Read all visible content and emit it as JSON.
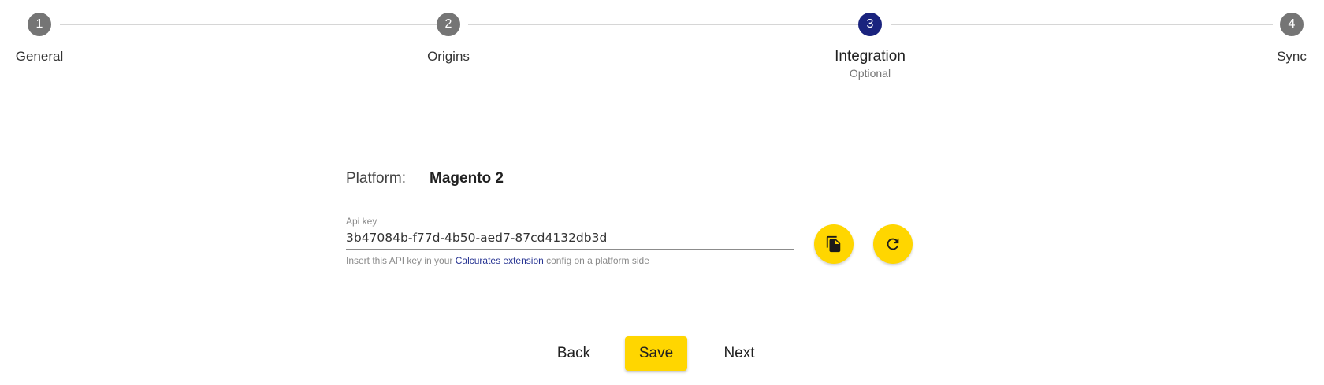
{
  "stepper": {
    "steps": [
      {
        "number": "1",
        "label": "General",
        "sublabel": "",
        "active": false
      },
      {
        "number": "2",
        "label": "Origins",
        "sublabel": "",
        "active": false
      },
      {
        "number": "3",
        "label": "Integration",
        "sublabel": "Optional",
        "active": true
      },
      {
        "number": "4",
        "label": "Sync",
        "sublabel": "",
        "active": false
      }
    ]
  },
  "platform": {
    "label": "Platform:",
    "value": "Magento 2"
  },
  "api_key": {
    "label": "Api key",
    "value": "3b47084b-f77d-4b50-aed7-87cd4132db3d",
    "hint_prefix": "Insert this API key in your ",
    "hint_link": "Calcurates extension",
    "hint_suffix": " config on a platform side",
    "copy_icon": "copy-icon",
    "refresh_icon": "refresh-icon"
  },
  "actions": {
    "back_label": "Back",
    "save_label": "Save",
    "next_label": "Next"
  },
  "colors": {
    "accent": "#ffd600",
    "active_step": "#1a237e",
    "inactive_step": "#757575",
    "link": "#283593"
  }
}
